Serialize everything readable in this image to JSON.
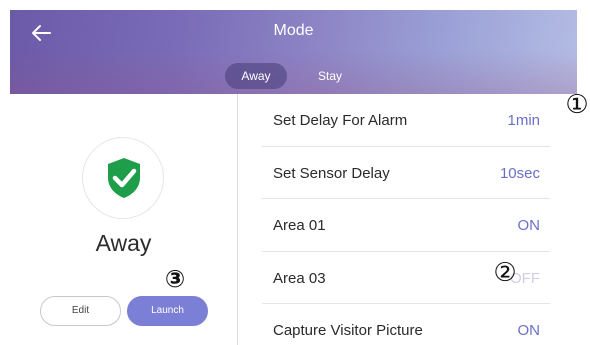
{
  "header": {
    "title": "Mode",
    "tabs": [
      {
        "label": "Away",
        "selected": true
      },
      {
        "label": "Stay",
        "selected": false
      }
    ]
  },
  "status": {
    "mode": "Away",
    "icon": "shield-check-icon",
    "icon_color": "#1e9e4a"
  },
  "buttons": {
    "edit": "Edit",
    "launch": "Launch"
  },
  "settings": [
    {
      "label": "Set Delay For Alarm",
      "value": "1min"
    },
    {
      "label": "Set Sensor Delay",
      "value": "10sec"
    },
    {
      "label": "Area 01",
      "value": "ON"
    },
    {
      "label": "Area 03",
      "value": "OFF"
    },
    {
      "label": "Capture Visitor Picture",
      "value": "ON"
    }
  ],
  "callouts": [
    "①",
    "②",
    "③"
  ],
  "colors": {
    "accent": "#7b7fd6",
    "value_text": "#6b6fc8"
  }
}
